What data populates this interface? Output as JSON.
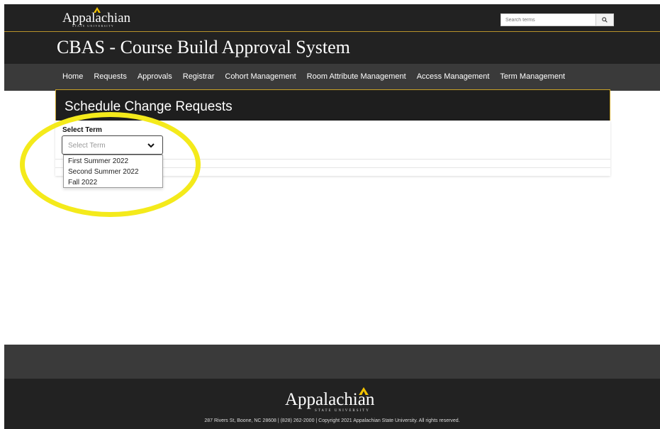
{
  "header": {
    "logo_text": "Appalachian",
    "logo_subtext": "STATE UNIVERSITY",
    "search_placeholder": "Search terms",
    "search_button_icon": "search-icon",
    "app_title": "CBAS - Course Build Approval System"
  },
  "nav": {
    "items": [
      "Home",
      "Requests",
      "Approvals",
      "Registrar",
      "Cohort Management",
      "Room Attribute Management",
      "Access Management",
      "Term Management"
    ]
  },
  "page": {
    "title": "Schedule Change Requests",
    "select_label": "Select Term",
    "select_placeholder": "Select Term",
    "term_options": [
      "First Summer 2022",
      "Second Summer 2022",
      "Fall 2022"
    ]
  },
  "footer": {
    "logo_text": "Appalachian",
    "logo_subtext": "STATE UNIVERSITY",
    "address": "287 Rivers St, Boone, NC 28608 | (828) 262-2000 | Copyright 2021 Appalachian State University. All rights reserved."
  },
  "colors": {
    "header_bg": "#222222",
    "nav_bg": "#3a3a3a",
    "accent_gold": "#c9a227",
    "highlight_yellow": "#f4ea1b"
  }
}
